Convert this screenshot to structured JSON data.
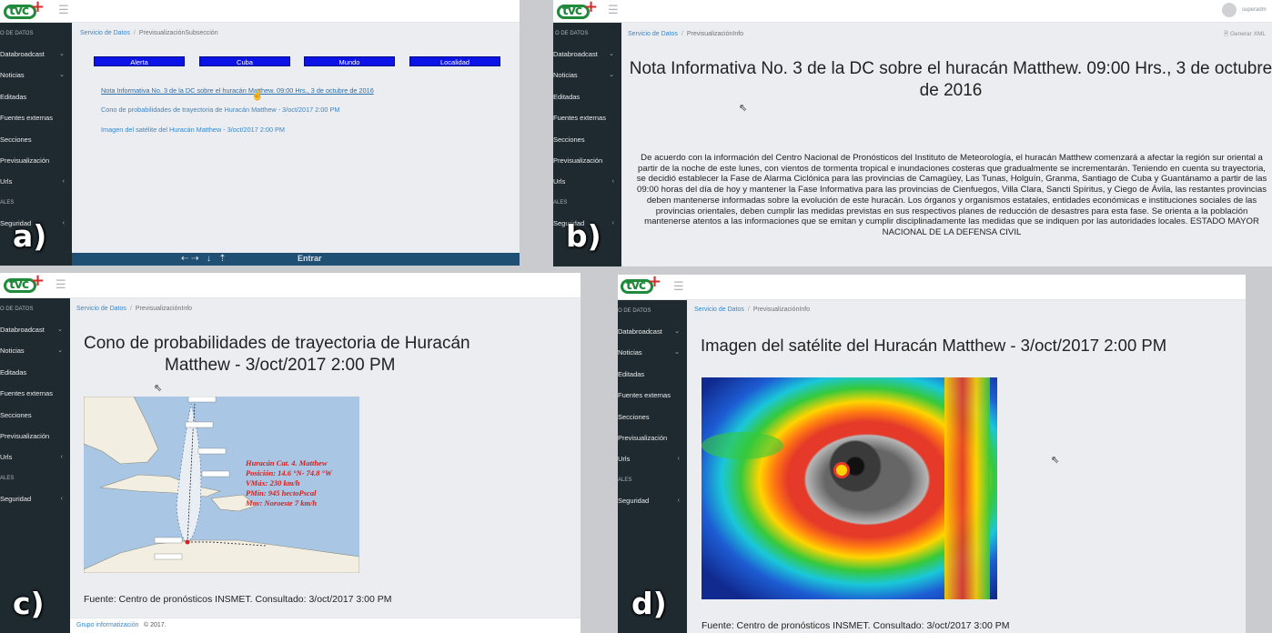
{
  "labels": {
    "a": "a)",
    "b": "b)",
    "c": "c)",
    "d": "d)"
  },
  "brand": {
    "logo_text": "tvc",
    "logo_plus": "+"
  },
  "colors": {
    "sidebar": "#1f2a30",
    "content_bg": "#ecedf0",
    "link": "#3a86c8",
    "button_blue": "#0b13e6",
    "logo_green": "#1e8a3a",
    "logo_red": "#d22c2c"
  },
  "sidebar": {
    "header": "O DE DATOS",
    "items": [
      {
        "label": "Databroadcast",
        "chev": "⌄"
      },
      {
        "label": "Noticias",
        "chev": "⌄"
      },
      {
        "label": "Editadas",
        "chev": ""
      },
      {
        "label": "Fuentes externas",
        "chev": ""
      },
      {
        "label": "Secciones",
        "chev": ""
      },
      {
        "label": "Previsualización",
        "chev": ""
      },
      {
        "label": "Urls",
        "chev": "‹"
      }
    ],
    "section_label": "ALES",
    "security": {
      "label": "Seguridad",
      "chev": "‹"
    }
  },
  "panel_a": {
    "breadcrumb": {
      "home": "Servicio de Datos",
      "current": "PrevisualizaciónSubsección"
    },
    "buttons": [
      "Alerta",
      "Cuba",
      "Mundo",
      "Localidad"
    ],
    "links": [
      "Nota Informativa No. 3 de la DC sobre el huracán Matthew. 09:00 Hrs., 3 de octubre de 2016",
      "Cono de probabilidades de trayectoria de Huracán Matthew - 3/oct/2017 2:00 PM",
      "Imagen del satélite del Huracán Matthew - 3/oct/2017 2:00 PM"
    ],
    "footer_text": "Entrar"
  },
  "panel_b": {
    "breadcrumb": {
      "home": "Servicio de Datos",
      "current": "PrevisualizaciónInfo"
    },
    "user": "superadm",
    "xml_button": "Generar XML",
    "title": "Nota Informativa No. 3 de la DC sobre el huracán Matthew. 09:00 Hrs., 3 de octubre de 2016",
    "body": "De acuerdo con la información del Centro Nacional de Pronósticos del Instituto de Meteorología, el huracán Matthew comenzará a afectar la región sur oriental a partir de la noche de este lunes, con vientos de tormenta tropical e inundaciones costeras que gradualmente se incrementarán. Teniendo en cuenta su trayectoria, se decidió establecer la Fase de Alarma Ciclónica para las provincias de Camagüey, Las Tunas, Holguín, Granma, Santiago de Cuba y Guantánamo a partir de las 09:00 horas del día de hoy y mantener la Fase Informativa para las provincias de Cienfuegos, Villa Clara, Sancti Spíritus, y Ciego de Ávila, las restantes provincias deben mantenerse informadas sobre la evolución de este huracán. Los órganos y organismos estatales, entidades económicas e instituciones sociales de las provincias orientales, deben cumplir las medidas previstas en sus respectivos planes de reducción de desastres para esta fase. Se orienta a la población mantenerse atentos a las informaciones que se emitan y cumplir disciplinadamente las medidas que se indiquen por las autoridades locales. ESTADO MAYOR NACIONAL DE LA DEFENSA CIVIL"
  },
  "panel_c": {
    "breadcrumb": {
      "home": "Servicio de Datos",
      "current": "PrevisualizaciónInfo"
    },
    "title_line1": "Cono de probabilidades de trayectoria de Huracán",
    "title_line2": "Matthew - 3/oct/2017  2:00 PM",
    "map_info": [
      "Huracán Cat. 4. Matthew",
      "Posición: 14.6 °N- 74.8 °W",
      "VMáx: 230 km/h",
      "PMín: 945 hectoPscal",
      "Mov: Noroeste 7 km/h"
    ],
    "source": "Fuente: Centro de pronósticos INSMET. Consultado: 3/oct/2017 3:00 PM",
    "footer_link": "Grupo informatización",
    "footer_text": "© 2017."
  },
  "panel_d": {
    "breadcrumb": {
      "home": "Servicio de Datos",
      "current": "PrevisualizaciónInfo"
    },
    "title": "Imagen del satélite del Huracán Matthew - 3/oct/2017 2:00 PM",
    "source": "Fuente: Centro de pronósticos INSMET. Consultado: 3/oct/2017 3:00 PM"
  }
}
